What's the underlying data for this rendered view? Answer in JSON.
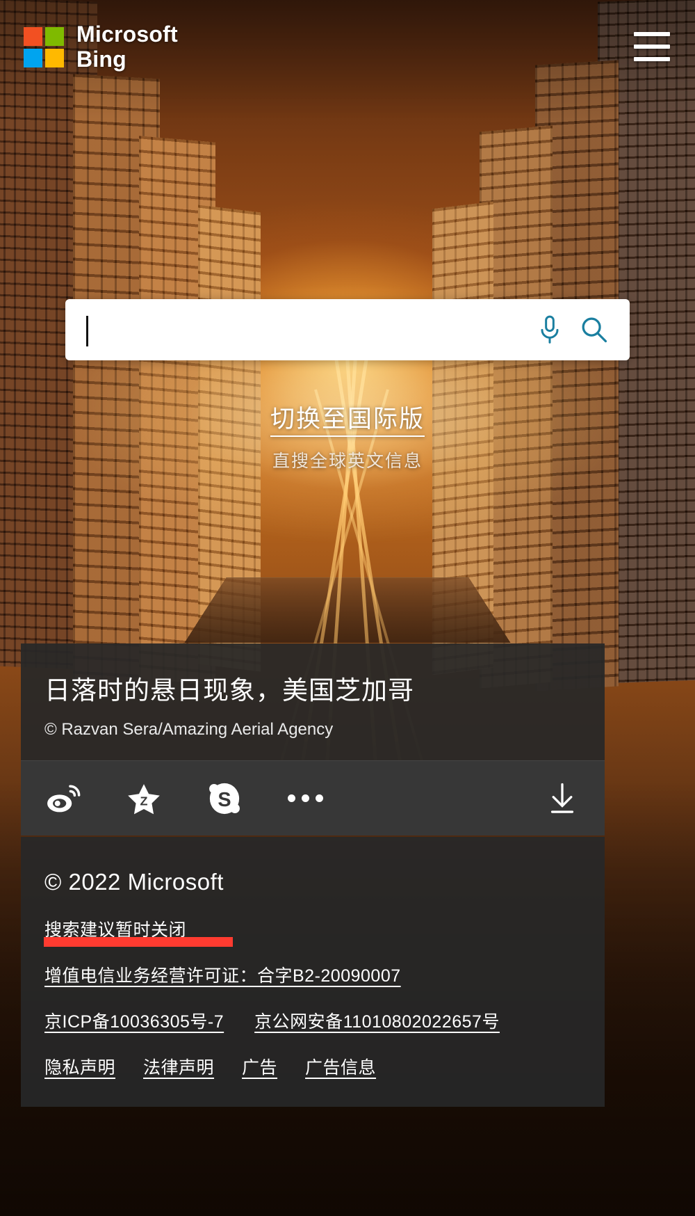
{
  "header": {
    "brand_line1": "Microsoft",
    "brand_line2": "Bing",
    "logo_colors": {
      "top_left": "#F25022",
      "top_right": "#7FBA00",
      "bottom_left": "#00A4EF",
      "bottom_right": "#FFB900"
    },
    "menu_icon": "hamburger-menu-icon"
  },
  "search": {
    "value": "",
    "placeholder": "",
    "mic_icon": "microphone-icon",
    "search_icon": "magnifier-icon",
    "icon_color": "#1a7fa0"
  },
  "intl": {
    "link_label": "切换至国际版",
    "subtitle": "直搜全球英文信息"
  },
  "image_info": {
    "title": "日落时的悬日现象，美国芝加哥",
    "credit": "© Razvan Sera/Amazing Aerial Agency",
    "actions": [
      {
        "name": "weibo-icon",
        "label": "微博"
      },
      {
        "name": "qzone-icon",
        "label": "QQ空间"
      },
      {
        "name": "skype-icon",
        "label": "Skype"
      },
      {
        "name": "more-icon",
        "label": "更多"
      }
    ],
    "download": {
      "name": "download-icon",
      "label": "下载"
    }
  },
  "footer": {
    "copyright": "© 2022 Microsoft",
    "suggest_notice": "搜索建议暂时关闭",
    "telecom_license": "增值电信业务经营许可证：合字B2-20090007",
    "icp": "京ICP备10036305号-7",
    "police": "京公网安备11010802022657号",
    "links": [
      "隐私声明",
      "法律声明",
      "广告",
      "广告信息"
    ],
    "highlight_color": "#ff3b30"
  }
}
